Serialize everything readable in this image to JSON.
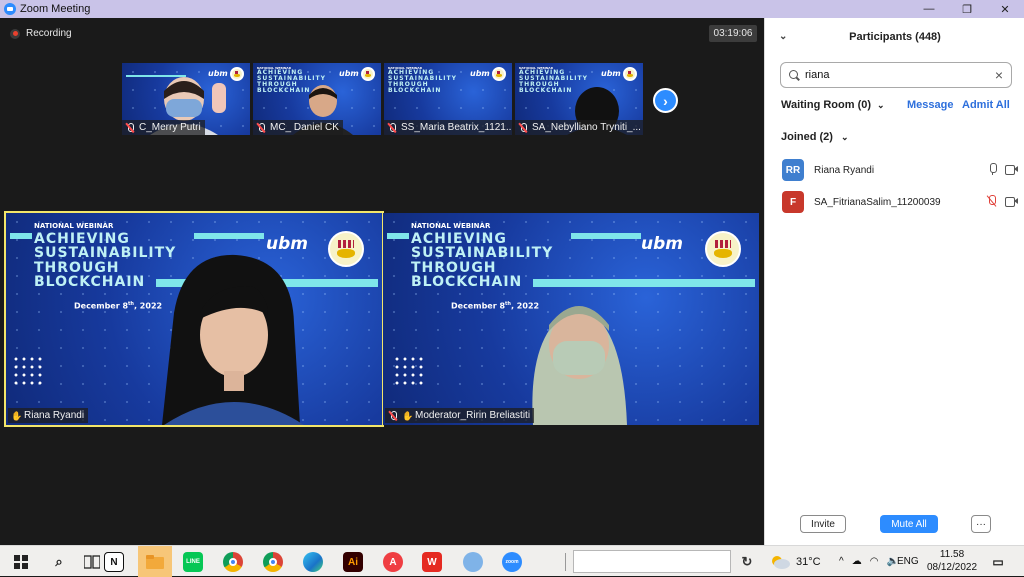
{
  "window": {
    "title": "Zoom Meeting"
  },
  "recording": {
    "label": "Recording",
    "timer": "03:19:06"
  },
  "slide": {
    "national": "NATIONAL WEBINAR",
    "headline": [
      "ACHIEVING",
      "SUSTAINABILITY",
      "THROUGH",
      "BLOCKCHAIN"
    ],
    "date": "December 8",
    "date_sup": "th",
    "date_year": ", 2022",
    "logo": "ubm"
  },
  "thumbnails": [
    {
      "name": "C_Merry Putri"
    },
    {
      "name": "MC_ Daniel CK"
    },
    {
      "name": "SS_Maria Beatrix_1121..."
    },
    {
      "name": "SA_Nebylliano Tryniti_..."
    }
  ],
  "tiles": [
    {
      "name": "Riana Ryandi"
    },
    {
      "name": "Moderator_Ririn Breliastiti"
    }
  ],
  "panel": {
    "title": "Participants (448)",
    "search_value": "riana",
    "waiting_room": "Waiting Room (0)",
    "message": "Message",
    "admit_all": "Admit All",
    "joined": "Joined (2)",
    "participants": [
      {
        "initials": "RR",
        "name": "Riana Ryandi",
        "color": "#3f7fcf"
      },
      {
        "initials": "F",
        "name": "SA_FitrianaSalim_11200039",
        "color": "#c8382b"
      }
    ],
    "invite": "Invite",
    "mute_all": "Mute All",
    "more": "···"
  },
  "taskbar": {
    "temperature": "31°C",
    "lang": "ENG",
    "time": "11.58",
    "date": "08/12/2022"
  },
  "colors": {
    "accent": "#2d8cff",
    "active_outline": "#f3e66a"
  }
}
